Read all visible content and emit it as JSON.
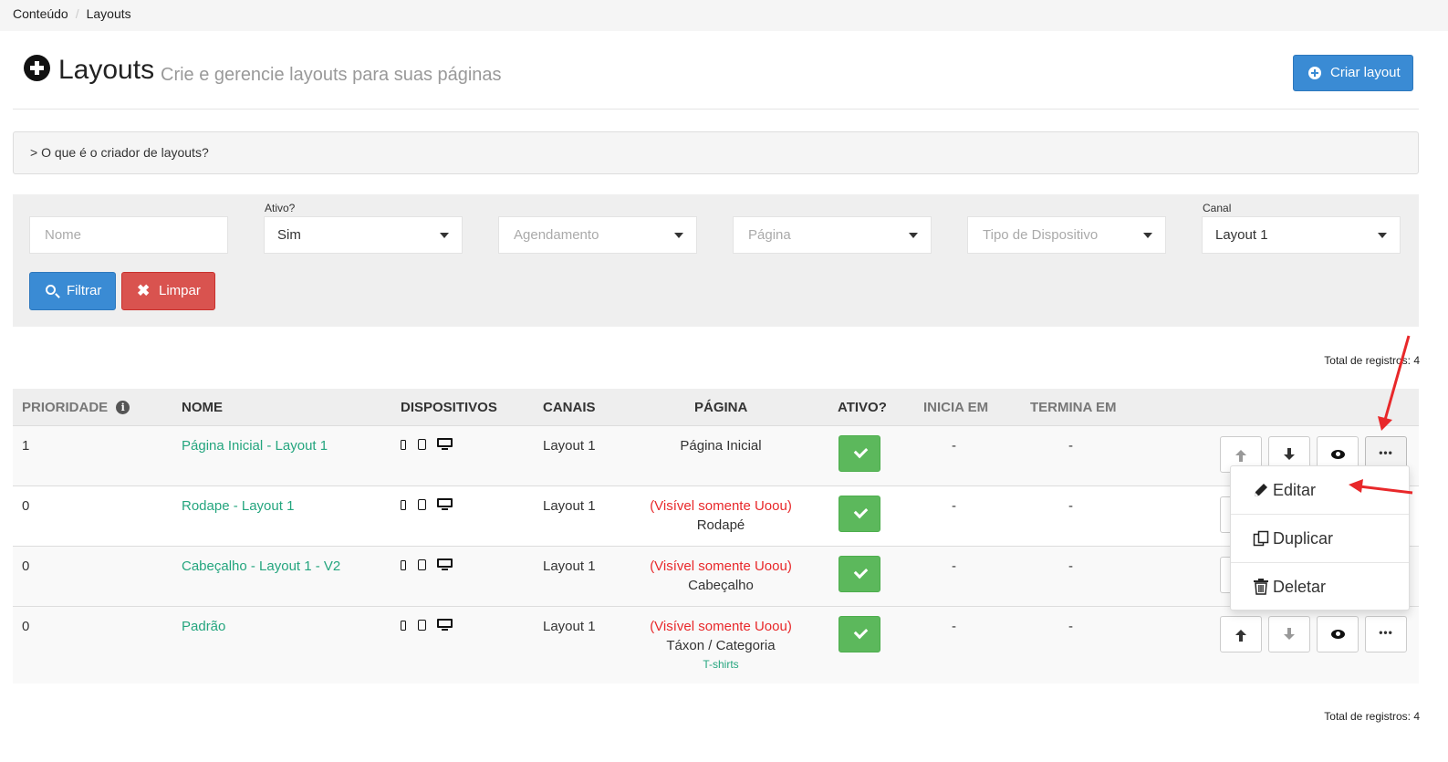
{
  "breadcrumb": {
    "items": [
      "Conteúdo",
      "Layouts"
    ],
    "separator": "/"
  },
  "header": {
    "title": "Layouts",
    "subtitle": "Crie e gerencie layouts para suas páginas",
    "create_button": "Criar layout"
  },
  "help": {
    "text": "> O que é o criador de layouts?"
  },
  "filters": {
    "name_placeholder": "Nome",
    "active_label": "Ativo?",
    "active_value": "Sim",
    "schedule_placeholder": "Agendamento",
    "page_placeholder": "Página",
    "device_placeholder": "Tipo de Dispositivo",
    "channel_label": "Canal",
    "channel_value": "Layout 1",
    "filter_button": "Filtrar",
    "clear_button": "Limpar"
  },
  "total_top": "Total de registros: 4",
  "total_bottom": "Total de registros: 4",
  "table": {
    "headers": [
      "PRIORIDADE",
      "NOME",
      "DISPOSITIVOS",
      "CANAIS",
      "PÁGINA",
      "ATIVO?",
      "INICIA EM",
      "TERMINA EM"
    ],
    "rows": [
      {
        "priority": "1",
        "name": "Página Inicial - Layout 1",
        "channel": "Layout 1",
        "visibility": "",
        "page": "Página Inicial",
        "tag": "",
        "start": "-",
        "end": "-"
      },
      {
        "priority": "0",
        "name": "Rodape - Layout 1",
        "channel": "Layout 1",
        "visibility": "(Visível somente Uoou)",
        "page": "Rodapé",
        "tag": "",
        "start": "-",
        "end": "-"
      },
      {
        "priority": "0",
        "name": "Cabeçalho - Layout 1 - V2",
        "channel": "Layout 1",
        "visibility": "(Visível somente Uoou)",
        "page": "Cabeçalho",
        "tag": "",
        "start": "-",
        "end": "-"
      },
      {
        "priority": "0",
        "name": "Padrão",
        "channel": "Layout 1",
        "visibility": "(Visível somente Uoou)",
        "page": "Táxon / Categoria",
        "tag": "T-shirts",
        "start": "-",
        "end": "-"
      }
    ]
  },
  "actions_menu": {
    "items": [
      "Editar",
      "Duplicar",
      "Deletar"
    ],
    "more_glyph": "•••"
  },
  "colors": {
    "primary": "#3a8bd4",
    "danger": "#d9534f",
    "success": "#5cb85c",
    "link": "#24a57e",
    "annotation_red": "#e8282a"
  }
}
